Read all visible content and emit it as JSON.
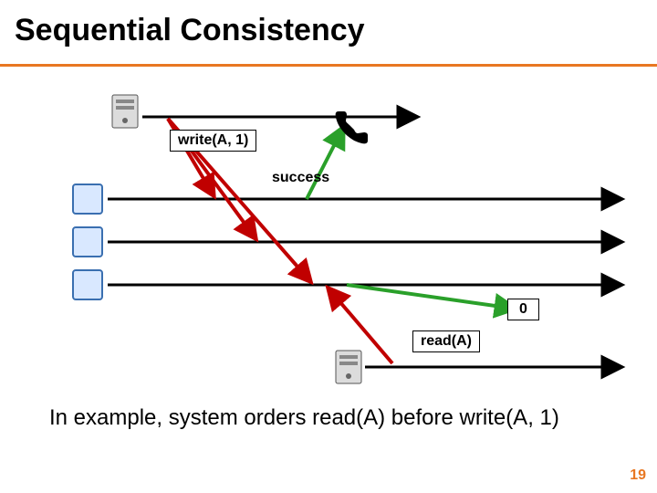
{
  "title": "Sequential Consistency",
  "labels": {
    "write": "write(A, 1)",
    "success": "success",
    "zero": "0",
    "read": "read(A)"
  },
  "caption": "In example, system orders read(A) before write(A, 1)",
  "slide_number": "19"
}
